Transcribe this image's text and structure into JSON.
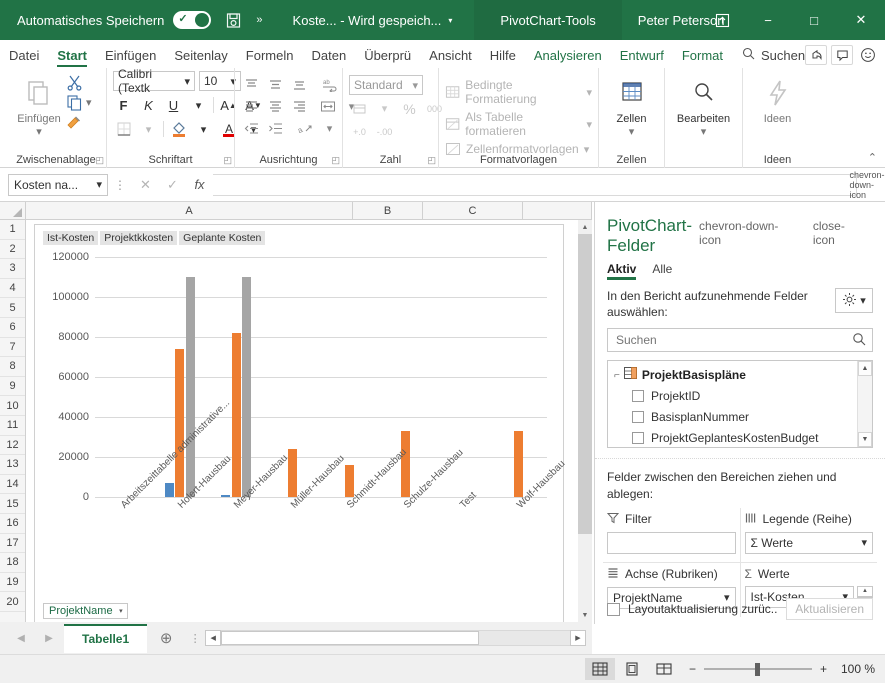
{
  "titlebar": {
    "autosave_label": "Automatisches Speichern",
    "autosave_state": "on",
    "save_icon": "save-icon",
    "more_icon": "more-chevrons-icon",
    "document_name": "Koste...  -  Wird gespeich...",
    "doc_caret": "▾",
    "context_tools": "PivotChart-Tools",
    "user_name": "Peter Peterson",
    "ribbon_display_icon": "ribbon-display-options-icon",
    "minimize": "−",
    "maximize": "□",
    "close": "✕"
  },
  "ribbon_tabs": {
    "items": [
      {
        "label": "Datei",
        "state": "normal"
      },
      {
        "label": "Start",
        "state": "active"
      },
      {
        "label": "Einfügen",
        "state": "normal"
      },
      {
        "label": "Seitenlay",
        "state": "normal"
      },
      {
        "label": "Formeln",
        "state": "normal"
      },
      {
        "label": "Daten",
        "state": "normal"
      },
      {
        "label": "Überprü",
        "state": "normal"
      },
      {
        "label": "Ansicht",
        "state": "normal"
      },
      {
        "label": "Hilfe",
        "state": "normal"
      },
      {
        "label": "Analysieren",
        "state": "contextual"
      },
      {
        "label": "Entwurf",
        "state": "contextual"
      },
      {
        "label": "Format",
        "state": "contextual"
      }
    ],
    "search_placeholder": "Suchen",
    "share_icon": "share-icon",
    "comments_icon": "comment-icon",
    "smiley_icon": "smiley-feedback-icon"
  },
  "ribbon": {
    "groups": [
      {
        "name": "Zwischenablage",
        "label": "Zwischenablage"
      },
      {
        "name": "Schriftart",
        "label": "Schriftart"
      },
      {
        "name": "Ausrichtung",
        "label": "Ausrichtung"
      },
      {
        "name": "Zahl",
        "label": "Zahl"
      },
      {
        "name": "Formatvorlagen",
        "label": "Formatvorlagen"
      },
      {
        "name": "Zellen",
        "label": "Zellen"
      },
      {
        "name": "Ideen",
        "label": "Ideen"
      }
    ],
    "clipboard": {
      "paste_label": "Einfügen",
      "cut_icon": "scissors-icon",
      "copy_icon": "copy-icon",
      "format_painter_icon": "format-painter-icon"
    },
    "font": {
      "family": "Calibri (Textk",
      "size": "10",
      "bold": "F",
      "italic": "K",
      "underline": "U",
      "grow_font": "A",
      "shrink_font": "A",
      "borders_icon": "borders-icon",
      "fill_icon": "fill-color-icon",
      "font_color_icon": "font-color-icon"
    },
    "number": {
      "format": "Standard",
      "accounting_icon": "accounting-format-icon",
      "percent": "%",
      "comma": "000",
      "dec_increase": "+.0",
      "dec_decrease": "-.00"
    },
    "styles": {
      "conditional": "Bedingte Formatierung",
      "as_table": "Als Tabelle formatieren",
      "cell_styles": "Zellenformatvorlagen"
    },
    "cells": {
      "label": "Zellen",
      "icon": "cells-icon"
    },
    "editing": {
      "label": "Bearbeiten",
      "icon": "search-magnifier-icon"
    },
    "ideas": {
      "label": "Ideen",
      "icon": "lightning-idea-icon"
    },
    "collapse_icon": "chevron-up-icon"
  },
  "formulabar": {
    "namebox_value": "Kosten na...",
    "namebox_caret": "▾",
    "cancel_icon": "cancel-x-icon",
    "confirm_icon": "confirm-check-icon",
    "function_icon": "fx",
    "formula_value": "",
    "expand_icon": "chevron-down-icon"
  },
  "worksheet": {
    "column_headers": [
      "A",
      "B",
      "C"
    ],
    "row_headers": [
      "1",
      "2",
      "3",
      "4",
      "5",
      "6",
      "7",
      "8",
      "9",
      "10",
      "11",
      "12",
      "13",
      "14",
      "15",
      "16",
      "17",
      "18",
      "19",
      "20"
    ],
    "field_button": "ProjektName",
    "field_button_caret": "▾"
  },
  "chart_data": {
    "type": "bar",
    "title": "",
    "xlabel": "",
    "ylabel": "",
    "ylim": [
      0,
      120000
    ],
    "ytick_values": [
      0,
      20000,
      40000,
      60000,
      80000,
      100000,
      120000
    ],
    "ytick_labels": [
      "0",
      "20000",
      "40000",
      "60000",
      "80000",
      "100000",
      "120000"
    ],
    "grid": true,
    "legend_position": "top-left",
    "categories": [
      "Arbeitszeittabelle administrative...",
      "Holert-Hausbau",
      "Meyer-Hausbau",
      "Müller-Hausbau",
      "Schmidt-Hausbau",
      "Schulze-Hausbau",
      "Test",
      "Wolf-Hausbau"
    ],
    "series": [
      {
        "name": "Ist-Kosten",
        "color": "#4E89C4",
        "values": [
          0,
          7000,
          800,
          0,
          0,
          0,
          0,
          0
        ]
      },
      {
        "name": "Projektkkosten",
        "color": "#ED7D31",
        "values": [
          0,
          74000,
          82000,
          24000,
          16000,
          33000,
          0,
          33000
        ]
      },
      {
        "name": "Geplante Kosten",
        "color": "#A5A5A5",
        "values": [
          0,
          110000,
          110000,
          0,
          0,
          0,
          0,
          0
        ]
      }
    ]
  },
  "sheettabs": {
    "prev_icon": "nav-prev-icon",
    "next_icon": "nav-next-icon",
    "tabs": [
      {
        "label": "Tabelle1",
        "active": true
      }
    ],
    "add_label": "+",
    "dots_icon": "tab-overflow-icon",
    "hscroll_left": "◀",
    "hscroll_right": "▶"
  },
  "taskpane": {
    "title": "PivotChart-Felder",
    "menu_icon": "chevron-down-icon",
    "close_icon": "close-icon",
    "tabs": [
      {
        "label": "Aktiv",
        "active": true
      },
      {
        "label": "Alle",
        "active": false
      }
    ],
    "instruction": "In den Bericht aufzunehmende Felder auswählen:",
    "tools_icon": "gear-icon",
    "tools_caret": "▾",
    "search_placeholder": "Suchen",
    "search_icon": "search-icon",
    "field_table": "ProjektBasispläne",
    "table_icon": "table-icon",
    "expand_icon": "collapse-minus-icon",
    "fields": [
      {
        "label": "ProjektID",
        "checked": false
      },
      {
        "label": "BasisplanNummer",
        "checked": false
      },
      {
        "label": "ProjektGeplantesKostenBudget",
        "checked": false
      }
    ],
    "drag_note": "Felder zwischen den Bereichen ziehen und ablegen:",
    "areas": [
      {
        "name": "filter",
        "title": "Filter",
        "icon": "filter-icon",
        "chip": ""
      },
      {
        "name": "legend",
        "title": "Legende (Reihe)",
        "icon": "columns-icon",
        "chip": "Σ  Werte"
      },
      {
        "name": "axis",
        "title": "Achse (Rubriken)",
        "icon": "rows-icon",
        "chip": "ProjektName"
      },
      {
        "name": "values",
        "title": "Werte",
        "icon": "sigma-icon",
        "chip": "Ist-Kosten"
      }
    ],
    "defer_label": "Layoutaktualisierung zurüc...",
    "update_button": "Aktualisieren",
    "defer_checked": false
  },
  "statusbar": {
    "views": [
      {
        "name": "normal-view",
        "icon": "grid-icon",
        "active": true
      },
      {
        "name": "page-layout-view",
        "icon": "page-icon",
        "active": false
      },
      {
        "name": "page-break-view",
        "icon": "pagebreak-icon",
        "active": false
      }
    ],
    "zoom_out": "−",
    "zoom_in": "+",
    "zoom_level": "100 %"
  },
  "colors": {
    "brand_green": "#217346",
    "contextual_green": "#1f6b41",
    "series_blue": "#4E89C4",
    "series_orange": "#ED7D31",
    "series_gray": "#A5A5A5"
  }
}
